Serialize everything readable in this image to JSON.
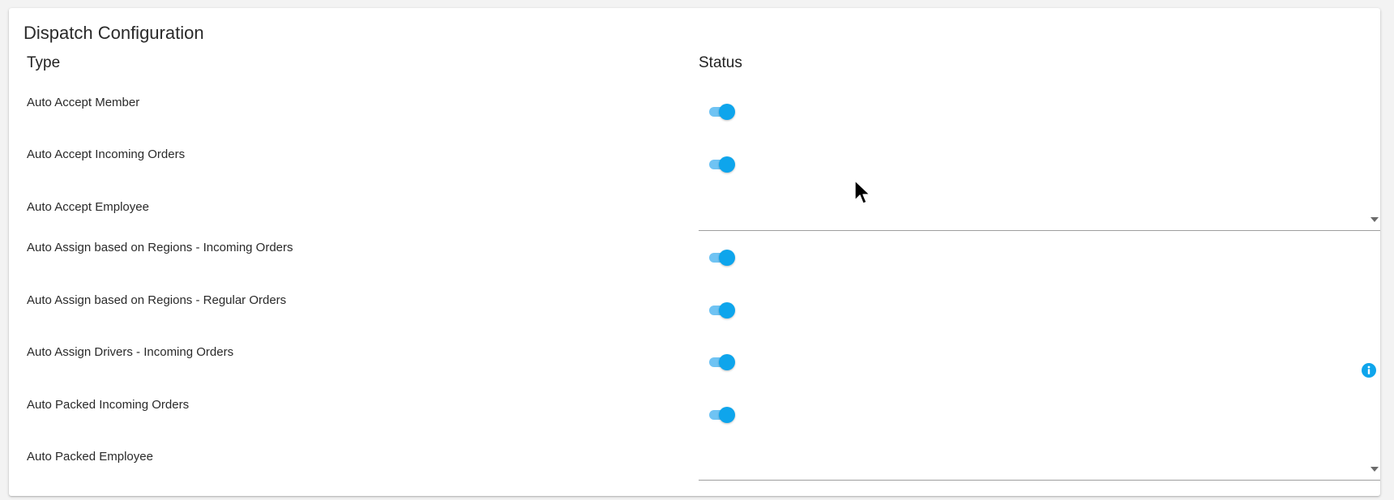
{
  "title": "Dispatch Configuration",
  "headers": {
    "type": "Type",
    "status": "Status"
  },
  "rows": [
    {
      "label": "Auto Accept Member",
      "control": "toggle",
      "checked": true
    },
    {
      "label": "Auto Accept Incoming Orders",
      "control": "toggle",
      "checked": true
    },
    {
      "label": "Auto Accept Employee",
      "control": "select",
      "value": ""
    },
    {
      "label": "Auto Assign based on Regions - Incoming Orders",
      "control": "toggle",
      "checked": true
    },
    {
      "label": "Auto Assign based on Regions - Regular Orders",
      "control": "toggle",
      "checked": true
    },
    {
      "label": "Auto Assign Drivers - Incoming Orders",
      "control": "toggle",
      "checked": true,
      "info_icon": "info-icon"
    },
    {
      "label": "Auto Packed Incoming Orders",
      "control": "toggle",
      "checked": true
    },
    {
      "label": "Auto Packed Employee",
      "control": "select",
      "value": ""
    }
  ],
  "colors": {
    "accent": "#0ea5ec",
    "accent_track": "#6fc3f3",
    "divider": "#9e9e9e"
  }
}
